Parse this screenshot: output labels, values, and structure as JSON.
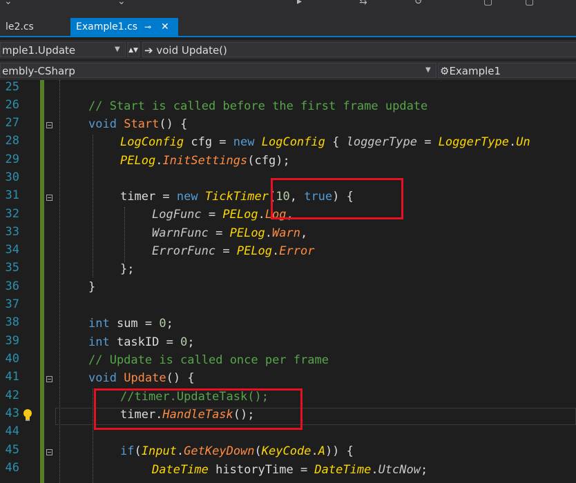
{
  "tabs": [
    {
      "label": "le2.cs",
      "active": false
    },
    {
      "label": "Example1.cs",
      "active": true,
      "pin": "⊸",
      "close": "✕"
    }
  ],
  "nav": {
    "member_scope": "mple1.Update",
    "method": "void Update()",
    "project": "embly-CSharp",
    "type": "Example1"
  },
  "line_numbers": [
    "25",
    "26",
    "27",
    "28",
    "29",
    "30",
    "31",
    "32",
    "33",
    "34",
    "35",
    "36",
    "37",
    "38",
    "39",
    "40",
    "41",
    "42",
    "43",
    "44",
    "45",
    "46"
  ],
  "code": {
    "l26": {
      "comment": "// Start is called before the first frame update"
    },
    "l27": {
      "kw": "void",
      "name": "Start",
      "rest": "() {"
    },
    "l28": {
      "t1": "LogConfig",
      "v1": " cfg = ",
      "kw": "new",
      "t2": "LogConfig",
      "b": " { ",
      "p": "loggerType",
      "eq": " = ",
      "t3": "LoggerType",
      "dot": ".",
      "e": "Un"
    },
    "l29": {
      "cls": "PELog",
      "dot": ".",
      "fn": "InitSettings",
      "rest": "(cfg);"
    },
    "l31": {
      "v": "timer = ",
      "kw": "new",
      "sp": " ",
      "ty": "TickTimer",
      "p1": "(",
      "n": "10",
      "c": ", ",
      "kw2": "true",
      "p2": ") {"
    },
    "l32": {
      "p": "LogFunc",
      "eq": " = ",
      "cls": "PELog",
      "dot": ".",
      "m": "Log",
      "end": ","
    },
    "l33": {
      "p": "WarnFunc",
      "eq": " = ",
      "cls": "PELog",
      "dot": ".",
      "m": "Warn",
      "end": ","
    },
    "l34": {
      "p": "ErrorFunc",
      "eq": " = ",
      "cls": "PELog",
      "dot": ".",
      "m": "Error"
    },
    "l35": {
      "text": "};"
    },
    "l36": {
      "text": "}"
    },
    "l38": {
      "kw": "int",
      "rest": " sum = ",
      "n": "0",
      "end": ";"
    },
    "l39": {
      "kw": "int",
      "rest": " taskID = ",
      "n": "0",
      "end": ";"
    },
    "l40": {
      "comment": "// Update is called once per frame"
    },
    "l41": {
      "kw": "void",
      "name": "Update",
      "rest": "() {"
    },
    "l42": {
      "comment": "//timer.UpdateTask();"
    },
    "l43": {
      "v": "timer.",
      "fn": "HandleTask",
      "rest": "();"
    },
    "l45": {
      "kw": "if",
      "p1": "(",
      "cls": "Input",
      "dot": ".",
      "fn": "GetKeyDown",
      "p2": "(",
      "ty": "KeyCode",
      "dot2": ".",
      "e": "A",
      "p3": ")) {"
    },
    "l46": {
      "t": "DateTime",
      "v": " historyTime = ",
      "t2": "DateTime",
      "dot": ".",
      "p": "UtcNow",
      "end": ";"
    }
  },
  "colors": {
    "accent": "#007acc",
    "highlight": "#e81123",
    "change_bar": "#577d2a"
  }
}
